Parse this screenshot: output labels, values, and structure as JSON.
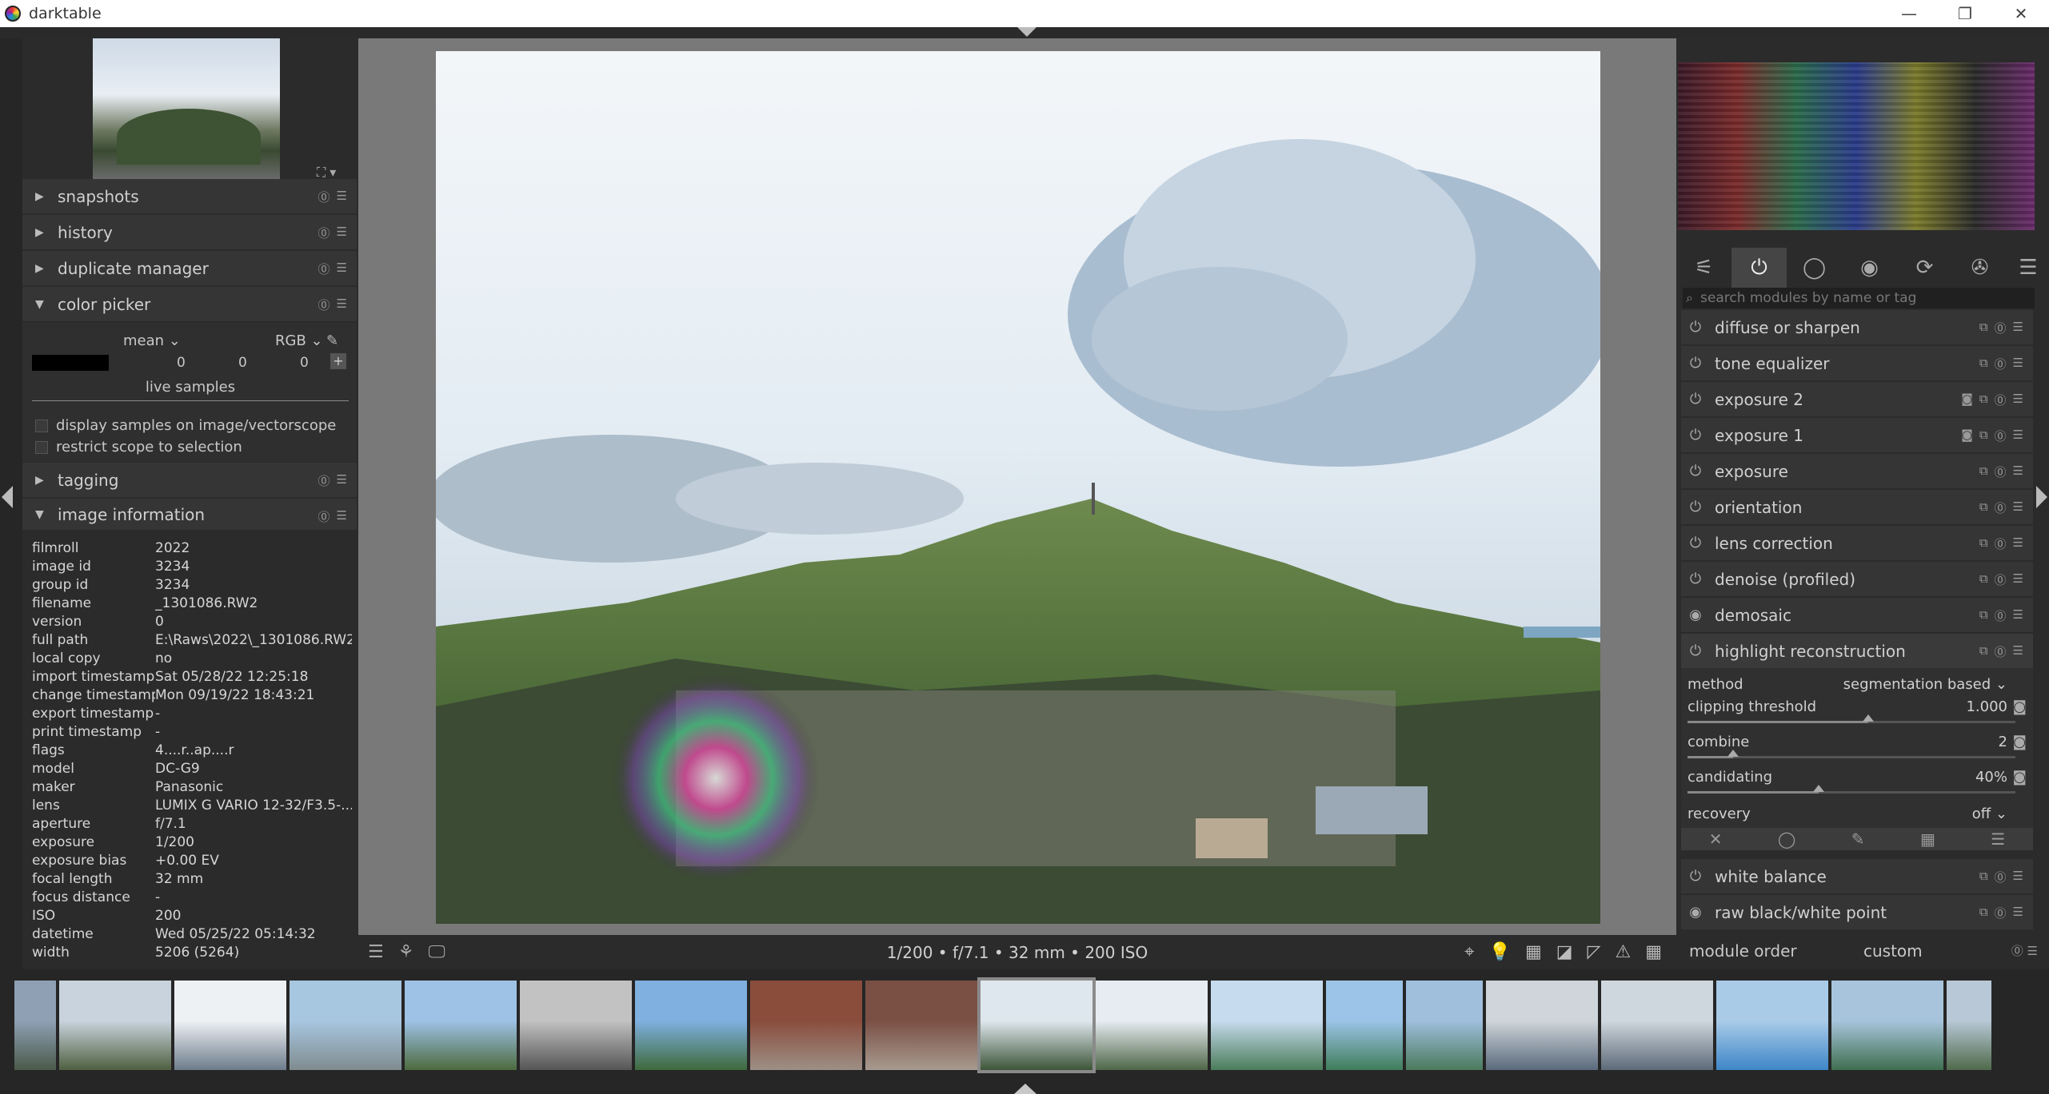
{
  "window": {
    "title": "darktable",
    "minimize": "—",
    "maximize": "❐",
    "close": "✕"
  },
  "left": {
    "modules": [
      {
        "label": "snapshots",
        "expanded": false
      },
      {
        "label": "history",
        "expanded": false
      },
      {
        "label": "duplicate manager",
        "expanded": false
      },
      {
        "label": "color picker",
        "expanded": true
      },
      {
        "label": "tagging",
        "expanded": false
      },
      {
        "label": "image information",
        "expanded": true
      }
    ],
    "color_picker": {
      "statistic": "mean",
      "color_mode": "RGB",
      "values": [
        "0",
        "0",
        "0"
      ],
      "live_samples": "live samples",
      "options": [
        "display samples on image/vectorscope",
        "restrict scope to selection"
      ]
    },
    "image_information": [
      {
        "key": "filmroll",
        "value": "2022"
      },
      {
        "key": "image id",
        "value": "3234"
      },
      {
        "key": "group id",
        "value": "3234"
      },
      {
        "key": "filename",
        "value": "_1301086.RW2"
      },
      {
        "key": "version",
        "value": "0"
      },
      {
        "key": "full path",
        "value": "E:\\Raws\\2022\\_1301086.RW2"
      },
      {
        "key": "local copy",
        "value": "no"
      },
      {
        "key": "import timestamp",
        "value": "Sat 05/28/22 12:25:18"
      },
      {
        "key": "change timestamp",
        "value": "Mon 09/19/22 18:43:21"
      },
      {
        "key": "export timestamp",
        "value": "-"
      },
      {
        "key": "print timestamp",
        "value": "-"
      },
      {
        "key": "flags",
        "value": "4....r..ap....r"
      },
      {
        "key": "model",
        "value": "DC-G9"
      },
      {
        "key": "maker",
        "value": "Panasonic"
      },
      {
        "key": "lens",
        "value": "LUMIX G VARIO 12-32/F3.5-..."
      },
      {
        "key": "aperture",
        "value": "f/7.1"
      },
      {
        "key": "exposure",
        "value": "1/200"
      },
      {
        "key": "exposure bias",
        "value": "+0.00 EV"
      },
      {
        "key": "focal length",
        "value": "32 mm"
      },
      {
        "key": "focus distance",
        "value": "-"
      },
      {
        "key": "ISO",
        "value": "200"
      },
      {
        "key": "datetime",
        "value": "Wed 05/25/22 05:14:32"
      },
      {
        "key": "width",
        "value": "5206 (5264)"
      }
    ]
  },
  "center": {
    "exif_line": "1/200 • f/7.1 • 32 mm • 200 ISO"
  },
  "right": {
    "search_placeholder": "search modules by name or tag",
    "modules": [
      {
        "label": "diffuse or sharpen"
      },
      {
        "label": "tone equalizer"
      },
      {
        "label": "exposure 2"
      },
      {
        "label": "exposure 1"
      },
      {
        "label": "exposure"
      },
      {
        "label": "orientation"
      },
      {
        "label": "lens correction"
      },
      {
        "label": "denoise (profiled)"
      },
      {
        "label": "demosaic"
      },
      {
        "label": "highlight reconstruction"
      }
    ],
    "highlight": {
      "method_label": "method",
      "method_value": "segmentation based",
      "clipping_label": "clipping threshold",
      "clipping_value": "1.000",
      "clipping_level": 0.55,
      "combine_label": "combine",
      "combine_value": "2",
      "combine_level": 0.14,
      "candidating_label": "candidating",
      "candidating_value": "40%",
      "candidating_level": 0.4,
      "recovery_label": "recovery",
      "recovery_value": "off"
    },
    "modules_after": [
      {
        "label": "white balance"
      },
      {
        "label": "raw black/white point"
      }
    ],
    "module_order_label": "module order",
    "module_order_value": "custom"
  }
}
